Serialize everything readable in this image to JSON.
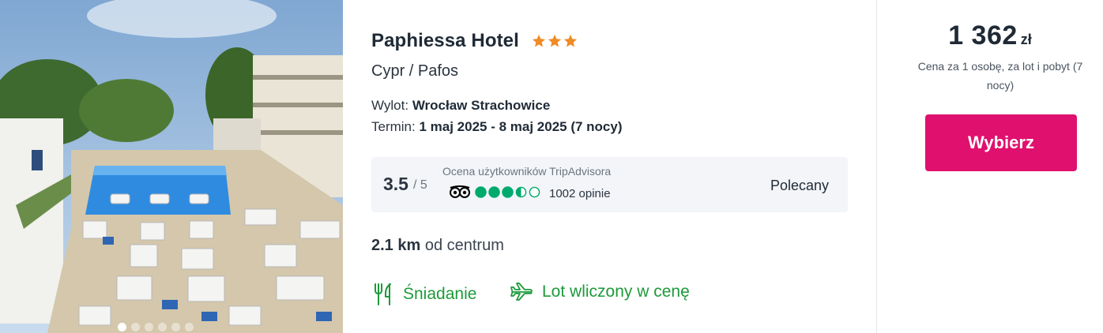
{
  "photo": {
    "alt_icon": "hotel-pool-photo",
    "carousel_count": 6,
    "carousel_active": 0
  },
  "hotel": {
    "name": "Paphiessa Hotel",
    "stars": 3,
    "location": "Cypr / Pafos",
    "departure_label": "Wylot:",
    "departure_value": "Wrocław Strachowice",
    "dates_label": "Termin:",
    "dates_value": "1 maj 2025 - 8 maj 2025 (7 nocy)"
  },
  "rating": {
    "score": "3.5",
    "scale": "/ 5",
    "source_label": "Ocena użytkowników TripAdvisora",
    "bubbles": 3.5,
    "reviews": "1002 opinie",
    "verdict": "Polecany"
  },
  "distance": {
    "value": "2.1 km",
    "suffix": "od centrum"
  },
  "amenities": [
    {
      "icon": "cutlery-icon",
      "label": "Śniadanie"
    },
    {
      "icon": "airplane-icon",
      "label": "Lot wliczony w cenę"
    }
  ],
  "price": {
    "amount": "1 362",
    "currency": "zł",
    "note": "Cena za 1 osobę, za lot i pobyt (7 nocy)"
  },
  "cta": {
    "label": "Wybierz"
  },
  "colors": {
    "accent": "#e0106e",
    "star": "#f08a24",
    "amenity_green": "#1d9a3a",
    "tripadvisor_green": "#00aa6c"
  }
}
